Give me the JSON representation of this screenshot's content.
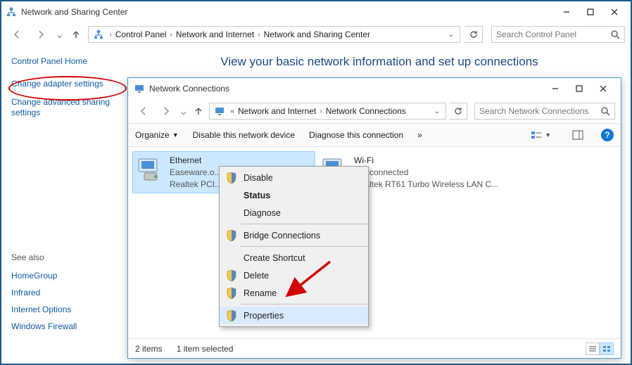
{
  "outer": {
    "title": "Network and Sharing Center",
    "breadcrumb": [
      "Control Panel",
      "Network and Internet",
      "Network and Sharing Center"
    ],
    "search_placeholder": "Search Control Panel",
    "heading": "View your basic network information and set up connections"
  },
  "sidebar": {
    "home": "Control Panel Home",
    "links": [
      "Change adapter settings",
      "Change advanced sharing settings"
    ],
    "see_also_header": "See also",
    "see_also": [
      "HomeGroup",
      "Infrared",
      "Internet Options",
      "Windows Firewall"
    ]
  },
  "inner": {
    "title": "Network Connections",
    "breadcrumb": [
      "Network and Internet",
      "Network Connections"
    ],
    "search_placeholder": "Search Network Connections",
    "toolbar": {
      "organize": "Organize",
      "disable": "Disable this network device",
      "diagnose": "Diagnose this connection",
      "more": "»"
    },
    "adapters": [
      {
        "name": "Ethernet",
        "line1": "Easeware.o...",
        "line2": "Realtek PCI...",
        "selected": true
      },
      {
        "name": "Wi-Fi",
        "line1": "Not connected",
        "line2": "Realtek RT61 Turbo Wireless LAN C...",
        "selected": false
      }
    ],
    "status": {
      "items": "2 items",
      "selected": "1 item selected"
    }
  },
  "context_menu": {
    "items": [
      {
        "label": "Disable",
        "shield": true
      },
      {
        "label": "Status",
        "bold": true
      },
      {
        "label": "Diagnose"
      },
      {
        "sep": true
      },
      {
        "label": "Bridge Connections",
        "shield": true
      },
      {
        "sep": true
      },
      {
        "label": "Create Shortcut"
      },
      {
        "label": "Delete",
        "shield": true
      },
      {
        "label": "Rename",
        "shield": true
      },
      {
        "sep": true
      },
      {
        "label": "Properties",
        "shield": true,
        "hover": true
      }
    ]
  }
}
